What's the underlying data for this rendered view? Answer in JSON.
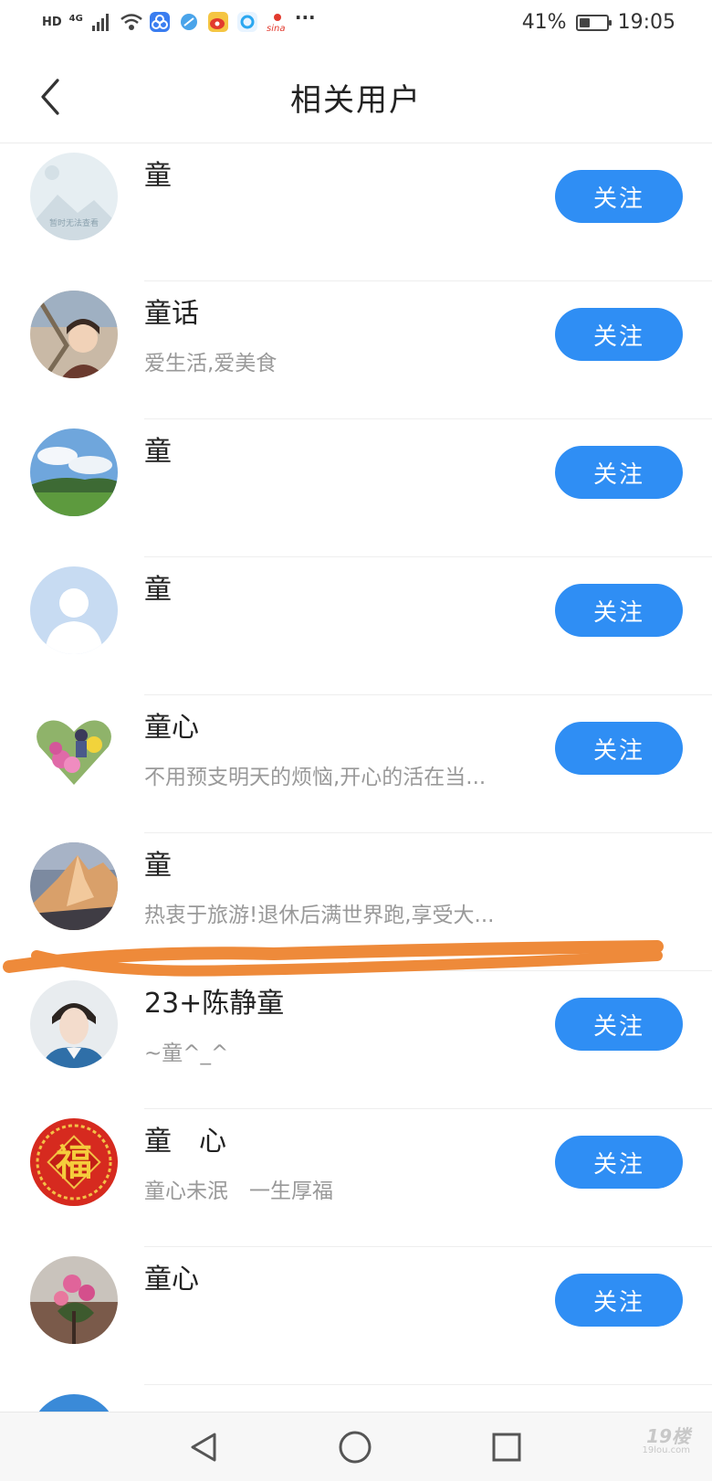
{
  "status_bar": {
    "network_label": "HD",
    "signal_label": "4G",
    "more_label": "···",
    "battery_percent": "41%",
    "battery_level": 0.41,
    "time": "19:05",
    "icons": [
      "wifi-icon",
      "app-icon",
      "browser-icon",
      "weibo-icon",
      "search-app-icon",
      "sina-icon"
    ]
  },
  "header": {
    "title": "相关用户",
    "back_icon": "chevron-left-icon"
  },
  "users": [
    {
      "name": "童",
      "bio": "",
      "follow_label": "关注",
      "avatar": "placeholder-image",
      "avatar_text": "暂时无法查看"
    },
    {
      "name": "童话",
      "bio": "爱生活,爱美食",
      "follow_label": "关注",
      "avatar": "photo-woman"
    },
    {
      "name": "童",
      "bio": "",
      "follow_label": "关注",
      "avatar": "photo-landscape"
    },
    {
      "name": "童",
      "bio": "",
      "follow_label": "关注",
      "avatar": "default-person"
    },
    {
      "name": "童心",
      "bio": "不用预支明天的烦恼,开心的活在当...",
      "follow_label": "关注",
      "avatar": "photo-heart-flowers"
    },
    {
      "name": "童",
      "bio": "热衷于旅游!退休后满世界跑,享受大...",
      "follow_label": "",
      "avatar": "photo-mountain"
    },
    {
      "name": "23+陈静童",
      "bio": "~童^_^",
      "follow_label": "关注",
      "avatar": "photo-young-man"
    },
    {
      "name": "童　心",
      "bio": "童心未泯　一生厚福",
      "follow_label": "关注",
      "avatar": "fu-character",
      "avatar_text": "福"
    },
    {
      "name": "童心",
      "bio": "",
      "follow_label": "关注",
      "avatar": "photo-flowers"
    }
  ],
  "nav_bar": {
    "back_icon": "triangle-back-icon",
    "home_icon": "circle-home-icon",
    "recent_icon": "square-recent-icon"
  },
  "watermark": {
    "main": "19楼",
    "sub": "19lou.com"
  },
  "colors": {
    "accent": "#2f8ef4",
    "annotation": "#ee8a3a"
  }
}
